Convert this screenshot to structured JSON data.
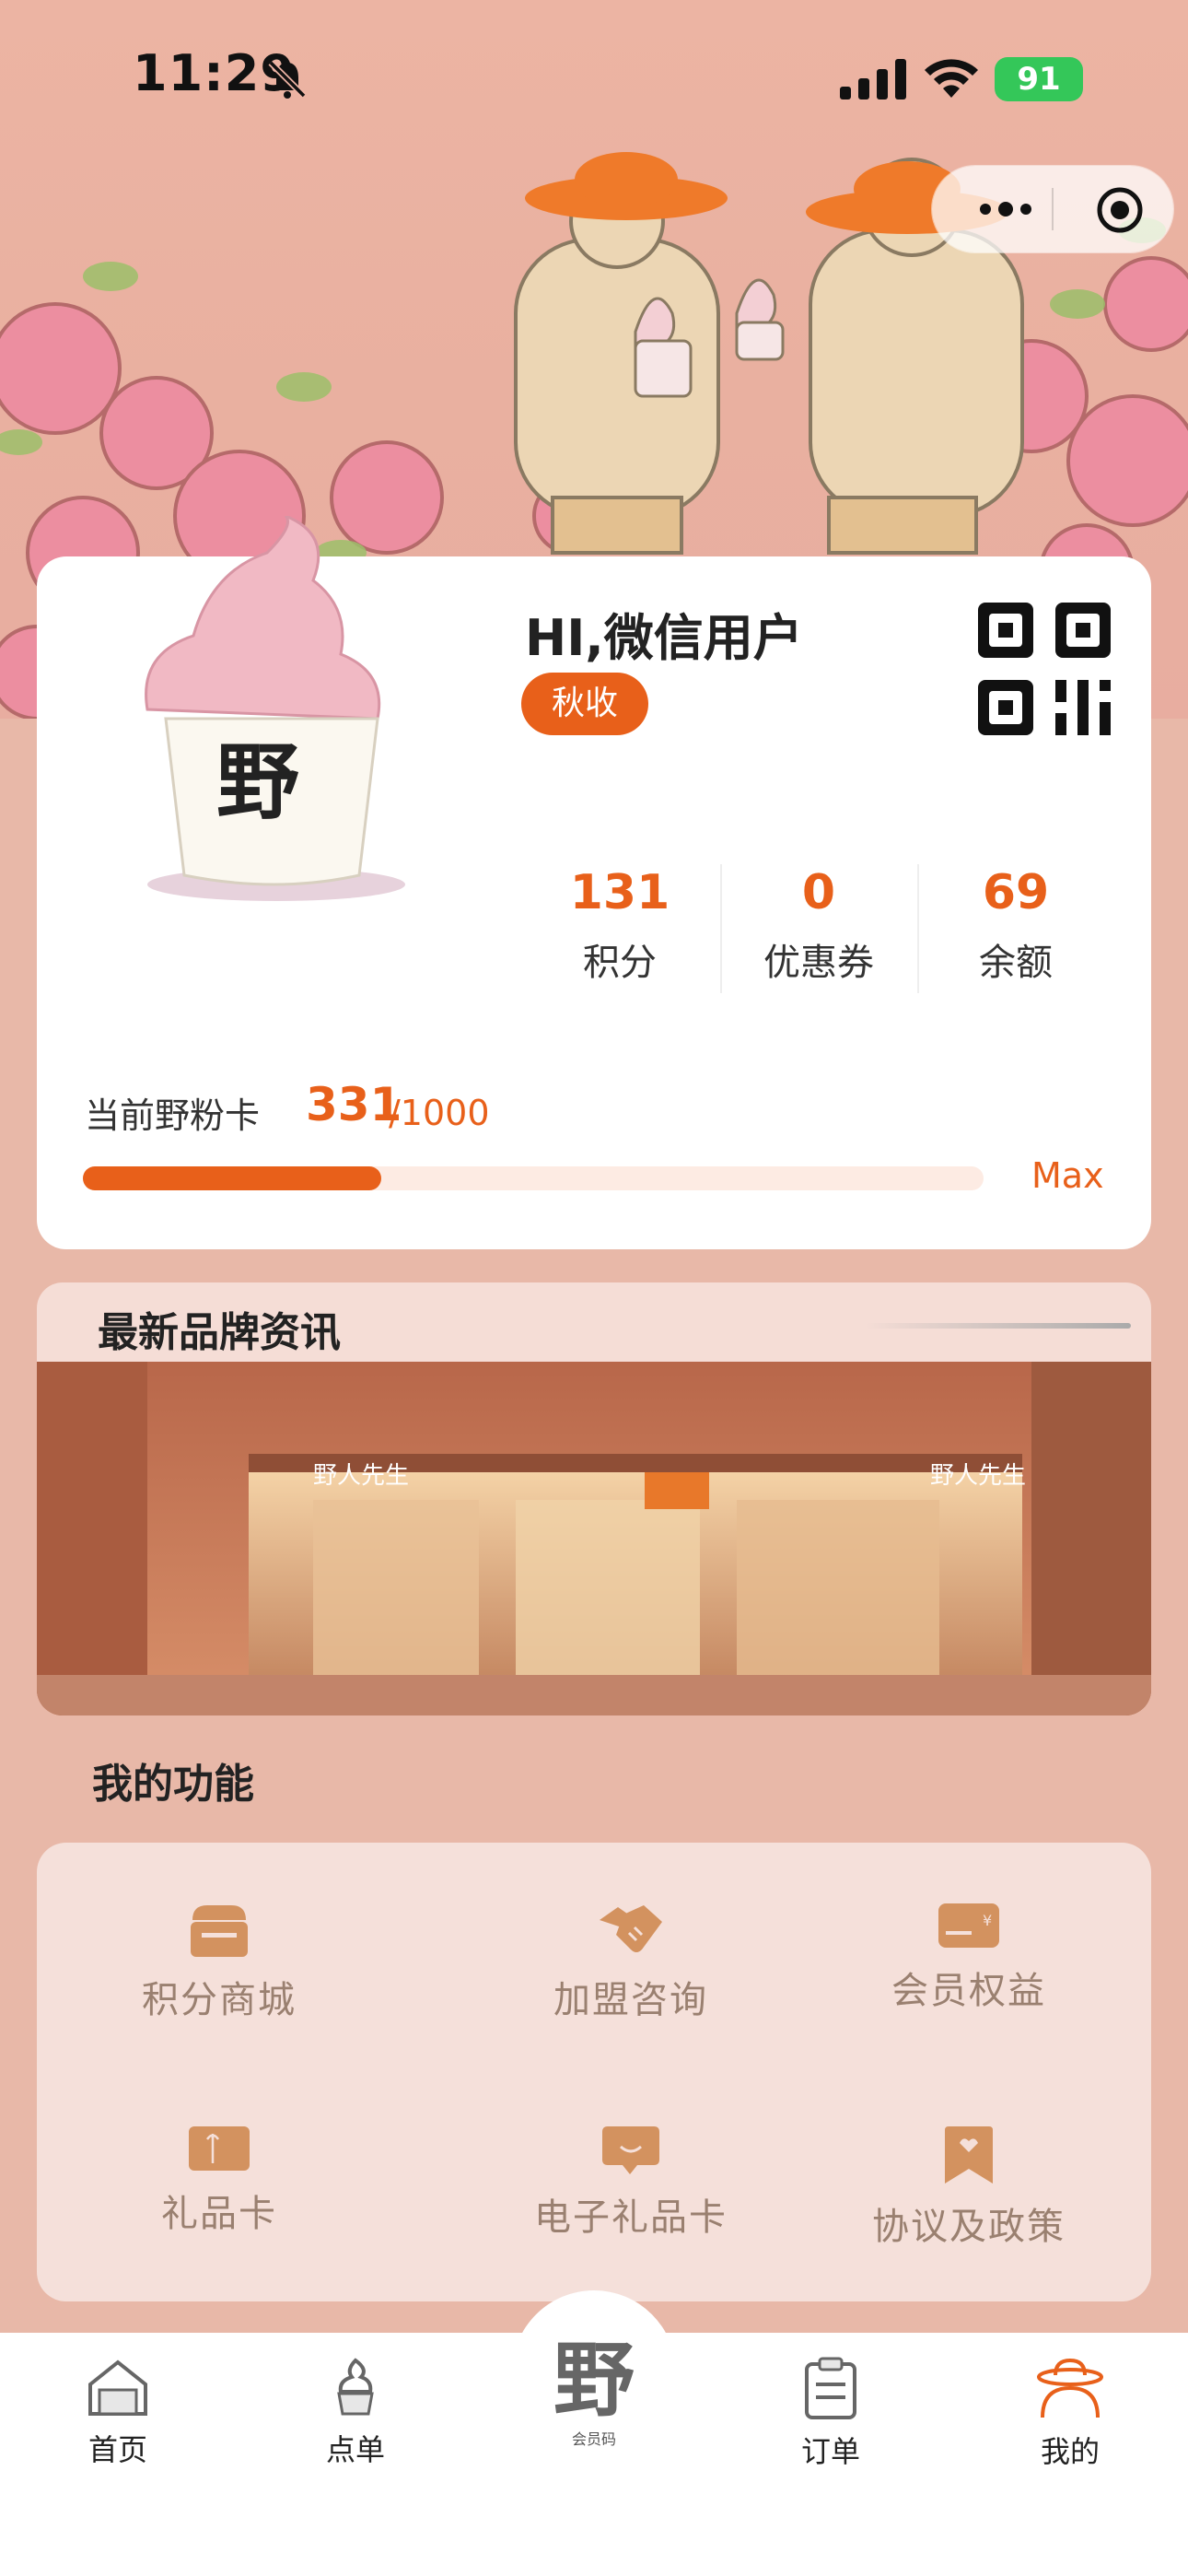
{
  "status_bar": {
    "time": "11:29",
    "battery": "91"
  },
  "member": {
    "greeting": "HI,微信用户",
    "level": "秋收",
    "stats": [
      {
        "value": "131",
        "label": "积分"
      },
      {
        "value": "0",
        "label": "优惠券"
      },
      {
        "value": "69",
        "label": "余额"
      }
    ],
    "fan_card_label": "当前野粉卡",
    "fan_points": "331",
    "fan_total": "/1000",
    "fan_progress": 0.331,
    "max_label": "Max"
  },
  "news": {
    "title": "最新品牌资讯"
  },
  "functions": {
    "title": "我的功能",
    "items": [
      {
        "label": "积分商城",
        "icon": "shop-icon"
      },
      {
        "label": "加盟咨询",
        "icon": "handshake-icon"
      },
      {
        "label": "会员权益",
        "icon": "card-icon"
      },
      {
        "label": "礼品卡",
        "icon": "gift-card-icon"
      },
      {
        "label": "电子礼品卡",
        "icon": "chat-gift-icon"
      },
      {
        "label": "协议及政策",
        "icon": "bookmark-icon"
      }
    ]
  },
  "tabbar": {
    "items": [
      {
        "label": "首页",
        "icon": "home-icon"
      },
      {
        "label": "点单",
        "icon": "icecream-icon"
      },
      {
        "label": "会员码",
        "icon": "member-code-icon"
      },
      {
        "label": "订单",
        "icon": "order-icon"
      },
      {
        "label": "我的",
        "icon": "profile-icon",
        "active": true
      }
    ]
  },
  "colors": {
    "accent": "#e8601a",
    "background": "#e8b8a8"
  }
}
